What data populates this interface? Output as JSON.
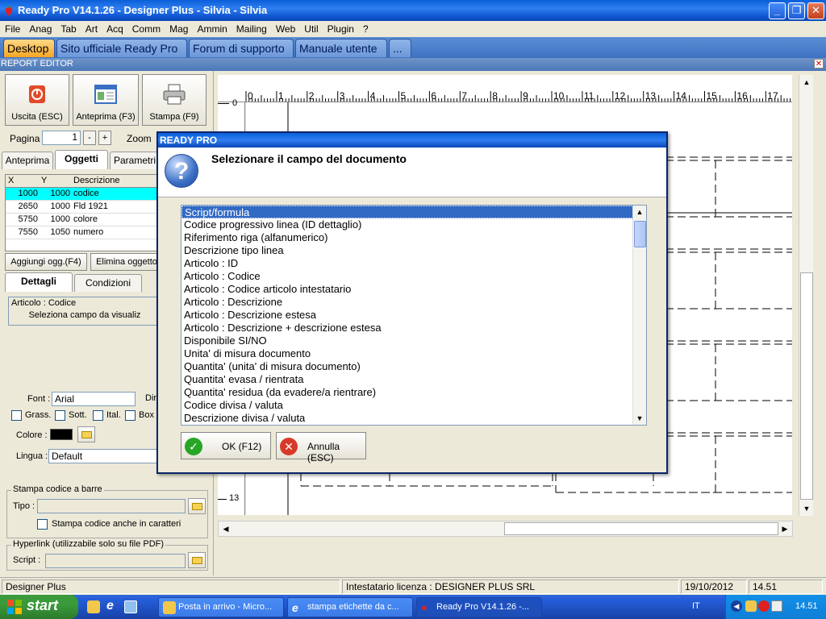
{
  "window": {
    "title": "Ready Pro V14.1.26 - Designer Plus - Silvia - Silvia"
  },
  "menu": [
    "File",
    "Anag",
    "Tab",
    "Art",
    "Acq",
    "Comm",
    "Mag",
    "Ammin",
    "Mailing",
    "Web",
    "Util",
    "Plugin",
    "?"
  ],
  "top_tabs": [
    "Desktop",
    "Sito ufficiale Ready Pro",
    "Forum di supporto",
    "Manuale utente",
    "..."
  ],
  "report_editor": {
    "label": "REPORT EDITOR"
  },
  "toolbar": {
    "exit": "Uscita (ESC)",
    "preview": "Anteprima (F3)",
    "print": "Stampa (F9)"
  },
  "paging": {
    "page_label": "Pagina",
    "page_value": "1",
    "minus": "-",
    "plus": "+",
    "zoom_label": "Zoom"
  },
  "left_tabs": [
    "Anteprima",
    "Oggetti",
    "Parametri"
  ],
  "objects_table": {
    "headers": [
      "X",
      "Y",
      "Descrizione"
    ],
    "rows": [
      {
        "x": "1000",
        "y": "1000",
        "desc": "codice"
      },
      {
        "x": "2650",
        "y": "1000",
        "desc": "Fld 1921"
      },
      {
        "x": "5750",
        "y": "1000",
        "desc": "colore"
      },
      {
        "x": "7550",
        "y": "1050",
        "desc": "numero"
      }
    ]
  },
  "object_buttons": {
    "add": "Aggiungi ogg.(F4)",
    "delete": "Elimina oggetto"
  },
  "detail_tabs": [
    "Dettagli",
    "Condizioni"
  ],
  "details": {
    "field_value": "Articolo : Codice",
    "select_field_btn": "Seleziona campo da visualiz",
    "font_label": "Font :",
    "font_value": "Arial",
    "dim_label": "Dir",
    "bold": "Grass.",
    "underline": "Sott.",
    "italic": "Ital.",
    "box": "Box",
    "color_label": "Colore :",
    "color_value": "#000000",
    "language_label": "Lingua :",
    "language_value": "Default",
    "barcode_group": "Stampa codice a barre",
    "type_label": "Tipo :",
    "barcode_text_chk": "Stampa codice anche in caratteri",
    "hyperlink_group": "Hyperlink (utilizzabile solo su file PDF)",
    "script_label": "Script :"
  },
  "ruler": {
    "top_numbers": [
      "0",
      "1",
      "2",
      "3",
      "4",
      "5",
      "6",
      "7",
      "8",
      "9",
      "10",
      "11",
      "12",
      "13",
      "14",
      "15",
      "16",
      "17"
    ],
    "left_labels": [
      "0",
      "13"
    ]
  },
  "dialog": {
    "title": "READY PRO",
    "message": "Selezionare il campo del documento",
    "items": [
      "Script/formula",
      "Codice progressivo linea (ID dettaglio)",
      "Riferimento riga (alfanumerico)",
      "Descrizione tipo linea",
      "Articolo : ID",
      "Articolo : Codice",
      "Articolo : Codice articolo intestatario",
      "Articolo : Descrizione",
      "Articolo : Descrizione estesa",
      "Articolo : Descrizione + descrizione estesa",
      "Disponibile SI/NO",
      "Unita' di misura documento",
      "Quantita' (unita' di misura documento)",
      "Quantita' evasa / rientrata",
      "Quantita' residua (da evadere/a rientrare)",
      "Codice divisa / valuta",
      "Descrizione divisa / valuta"
    ],
    "selected_index": 0,
    "ok": "OK (F12)",
    "cancel": "Annulla (ESC)"
  },
  "statusbar": {
    "app": "Designer Plus",
    "license": "Intestatario licenza : DESIGNER PLUS SRL",
    "date": "19/10/2012",
    "time": "14.51"
  },
  "taskbar": {
    "start": "start",
    "items": [
      "Posta in arrivo - Micro...",
      "stampa etichette da c...",
      "Ready Pro V14.1.26 -..."
    ],
    "lang": "IT",
    "clock": "14.51"
  }
}
